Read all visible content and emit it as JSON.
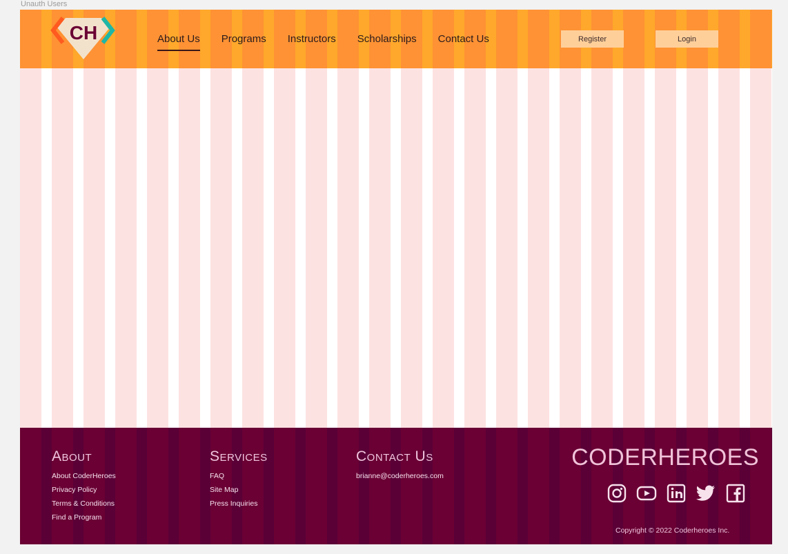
{
  "frame": {
    "label": "Unauth Users"
  },
  "header": {
    "logo_text": "CH",
    "nav": [
      {
        "label": "About Us",
        "active": true
      },
      {
        "label": "Programs",
        "active": false
      },
      {
        "label": "Instructors",
        "active": false
      },
      {
        "label": "Scholarships",
        "active": false
      },
      {
        "label": "Contact Us",
        "active": false
      }
    ],
    "register_label": "Register",
    "login_label": "Login"
  },
  "footer": {
    "about": {
      "title": "About",
      "links": [
        "About CoderHeroes",
        "Privacy Policy",
        "Terms & Conditions",
        "Find a Program"
      ]
    },
    "services": {
      "title": "Services",
      "links": [
        "FAQ",
        "Site Map",
        "Press Inquiries"
      ]
    },
    "contact": {
      "title": "Contact Us",
      "email": "brianne@coderheroes.com"
    },
    "brand": "CODERHEROES",
    "social_icons": [
      "instagram-icon",
      "youtube-icon",
      "linkedin-icon",
      "twitter-icon",
      "facebook-icon"
    ],
    "copyright": "Copyright © 2022 Coderheroes Inc."
  },
  "colors": {
    "header_bg": "#fe9234",
    "grid_column": "#fde2e2",
    "footer_bg": "#6a0034",
    "footer_text": "#f0c6dd",
    "button_bg": "#ffcf9a"
  }
}
